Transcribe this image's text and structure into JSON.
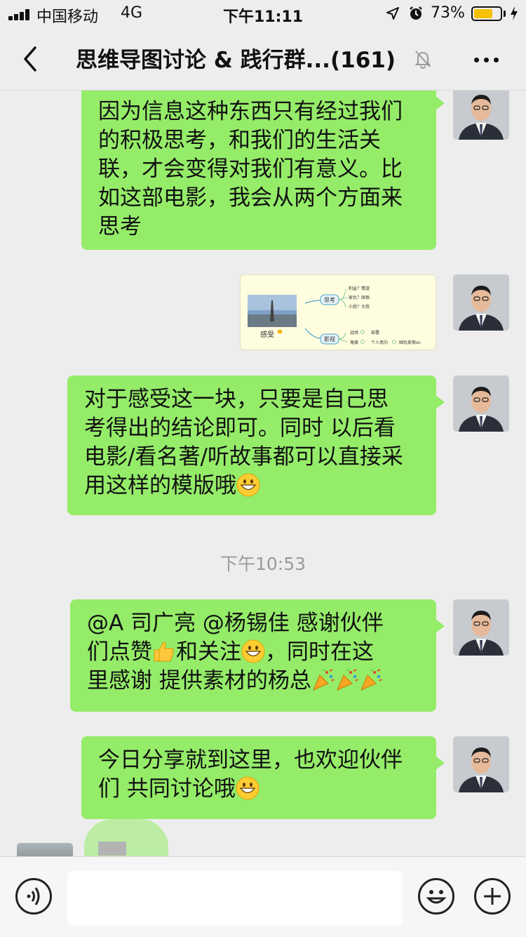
{
  "status_bar": {
    "carrier": "中国移动",
    "network": "4G",
    "time": "下午11:11",
    "battery_percent": "73%",
    "battery_level": 0.73
  },
  "nav": {
    "title": "思维导图讨论 & 践行群...",
    "member_count": "(161)"
  },
  "messages": [
    {
      "lines": [
        "因为信息这种东西只有经过我们",
        "的积极思考，和我们的生活关",
        "联，才会变得对我们有意义。比",
        "如这部电影，我会从两个方面来",
        "思考"
      ]
    },
    {
      "mindmap": {
        "center": "感受",
        "branch1": "思考",
        "branch1_leaves": [
          "利益？情谊",
          "家仇？国恨",
          "小我？大我"
        ],
        "branch2": "影视",
        "branch2_leaves": [
          "战场",
          "部署",
          "角度",
          "个人意向",
          "国仇家恨sn"
        ]
      }
    },
    {
      "lines": [
        "对于感受这一块，只要是自己思",
        "考得出的结论即可。同时 以后看",
        "电影/看名著/听故事都可以直接采",
        "用这样的模版哦"
      ]
    },
    {
      "timestamp": "下午10:53"
    },
    {
      "lines": [
        "@A   司广亮 @杨锡佳 感谢伙伴",
        "们点赞",
        "和关注",
        "，同时在这",
        "里感谢 提供素材的杨总"
      ]
    },
    {
      "lines": [
        "今日分享就到这里，也欢迎伙伴",
        "们 共同讨论哦"
      ]
    }
  ],
  "icons": {
    "back": "chevron-left-icon",
    "mute": "bell-off-icon",
    "more": "more-dots-icon",
    "voice": "voice-icon",
    "emoji": "emoji-icon",
    "plus": "plus-icon"
  },
  "colors": {
    "bubble": "#95ec69",
    "background": "#ededed",
    "battery": "#f5c100"
  }
}
